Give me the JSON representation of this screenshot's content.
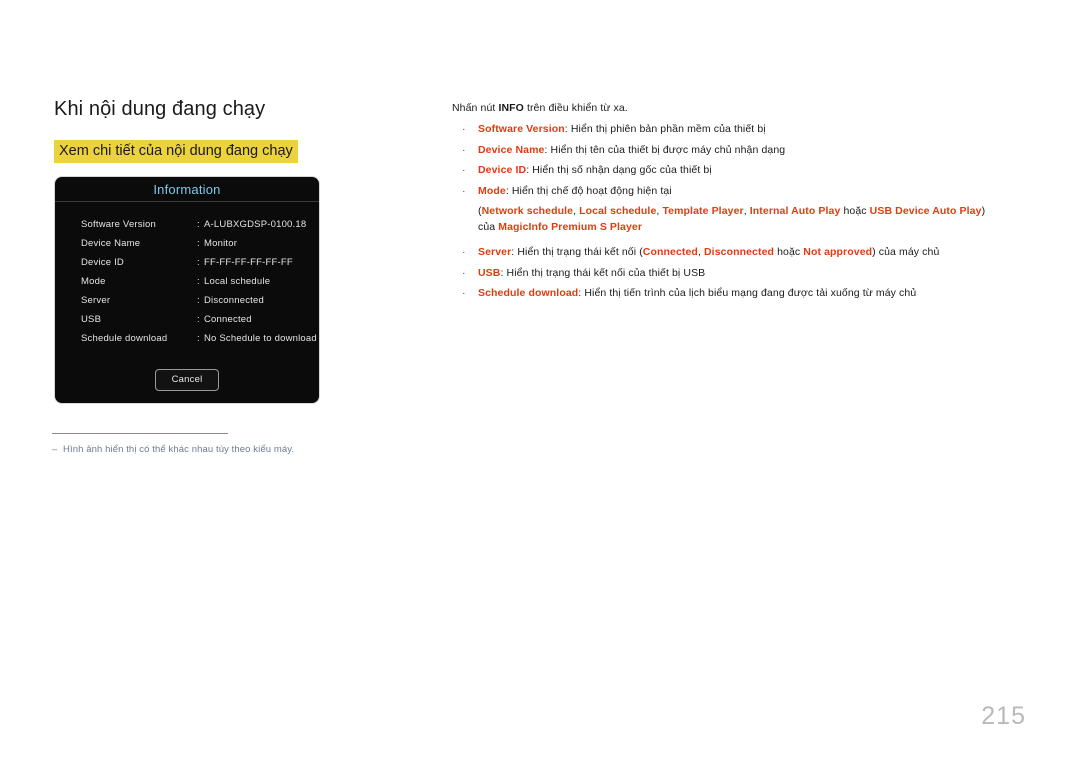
{
  "page": {
    "heading": "Khi nội dung đang chạy",
    "sub_heading": "Xem chi tiết của nội dung đang chạy",
    "page_number": "215",
    "highlight_color": "#ecd23c",
    "keyword_color": "#e23b10",
    "osd_title_color": "#7ec8e8",
    "footnote_color": "#6d7a92"
  },
  "dialog": {
    "title": "Information",
    "rows": [
      {
        "label": "Software Version",
        "value": "A-LUBXGDSP-0100.18"
      },
      {
        "label": "Device Name",
        "value": "Monitor"
      },
      {
        "label": "Device ID",
        "value": "FF-FF-FF-FF-FF-FF"
      },
      {
        "label": "Mode",
        "value": "Local schedule"
      },
      {
        "label": "Server",
        "value": "Disconnected"
      },
      {
        "label": "USB",
        "value": "Connected"
      },
      {
        "label": "Schedule download",
        "value": "No Schedule to download"
      }
    ],
    "colon": ":",
    "cancel_label": "Cancel"
  },
  "footnote": {
    "dash": "‒",
    "text": "Hình ảnh hiển thị có thể khác nhau tùy theo kiểu máy."
  },
  "body": {
    "intro_before": "Nhấn nút ",
    "intro_bold": "INFO",
    "intro_after": " trên điều khiển từ xa.",
    "bullet_char": "·",
    "items": {
      "software_version": {
        "keyword": "Software Version",
        "desc": ": Hiển thị phiên bản phần mềm của thiết bị"
      },
      "device_name": {
        "keyword": "Device Name",
        "desc": ": Hiển thị tên của thiết bị được máy chủ nhận dạng"
      },
      "device_id": {
        "keyword": "Device ID",
        "desc": ": Hiển thị số nhận dạng gốc của thiết bị"
      },
      "mode": {
        "keyword": "Mode",
        "desc": ": Hiển thị chế độ hoạt động hiện tại",
        "sub_open": "(",
        "opt1": "Network schedule",
        "sep1": ", ",
        "opt2": "Local schedule",
        "sep2": ", ",
        "opt3": "Template Player",
        "sep3": ", ",
        "opt4": "Internal Auto Play",
        "sep4": " hoặc ",
        "opt5": "USB Device Auto Play",
        "sub_close": ")",
        "sub_line2_before": "của ",
        "sub_line2_kw": "MagicInfo Premium S Player"
      },
      "server": {
        "keyword": "Server",
        "desc_a": ": Hiển thị trạng thái kết nối (",
        "state1": "Connected",
        "sep1": ", ",
        "state2": "Disconnected",
        "sep2": " hoặc ",
        "state3": "Not approved",
        "desc_b": ") của máy chủ"
      },
      "usb": {
        "keyword": "USB",
        "desc": ": Hiển thị trạng thái kết nối của thiết bị USB"
      },
      "schedule_download": {
        "keyword": "Schedule download",
        "desc": ": Hiển thị tiến trình của lịch biểu mạng đang được tải xuống từ máy chủ"
      }
    }
  }
}
